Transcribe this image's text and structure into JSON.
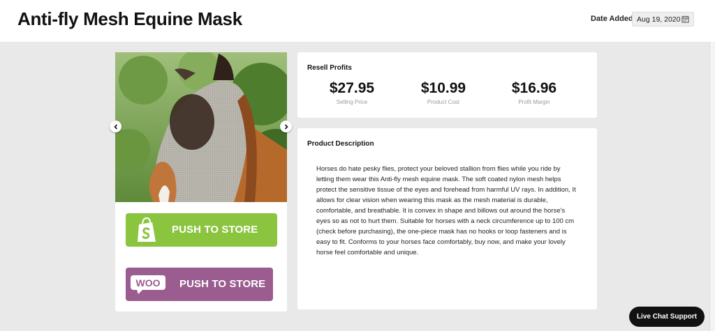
{
  "header": {
    "title": "Anti-fly Mesh Equine Mask",
    "date_label": "Date Added:",
    "date_value": "Aug 19, 2020"
  },
  "carousel": {
    "image_alt": "Horse wearing anti-fly mesh mask",
    "prev_icon": "chevron-left-icon",
    "next_icon": "chevron-right-icon"
  },
  "buttons": {
    "shopify_label": "PUSH TO STORE",
    "woo_label": "PUSH TO STORE",
    "woo_logo_text": "WOO",
    "shopify_color": "#8bc53f",
    "woo_color": "#9b5c8f"
  },
  "profits": {
    "title": "Resell Profits",
    "stats": [
      {
        "value": "$27.95",
        "label": "Selling Price"
      },
      {
        "value": "$10.99",
        "label": "Product Cost"
      },
      {
        "value": "$16.96",
        "label": "Profit Margin"
      }
    ]
  },
  "description": {
    "title": "Product Description",
    "text": "Horses do hate pesky flies, protect your beloved stallion from flies while you ride by letting them wear this Anti-fly mesh equine mask. The soft coated nylon mesh helps protect the sensitive tissue of the eyes and forehead from harmful UV rays. In addition, It allows for clear vision when wearing this mask as the mesh material is durable, comfortable, and breathable. It is convex in shape and billows out around the horse's eyes so as not to hurt them. Suitable for horses with a neck circumference up to 100 cm (check before purchasing), the one-piece mask has no hooks or loop fasteners and is easy to fit. Conforms to your horses face comfortably, buy now, and make your lovely horse feel comfortable and unique."
  },
  "chat": {
    "label": "Live Chat Support"
  }
}
